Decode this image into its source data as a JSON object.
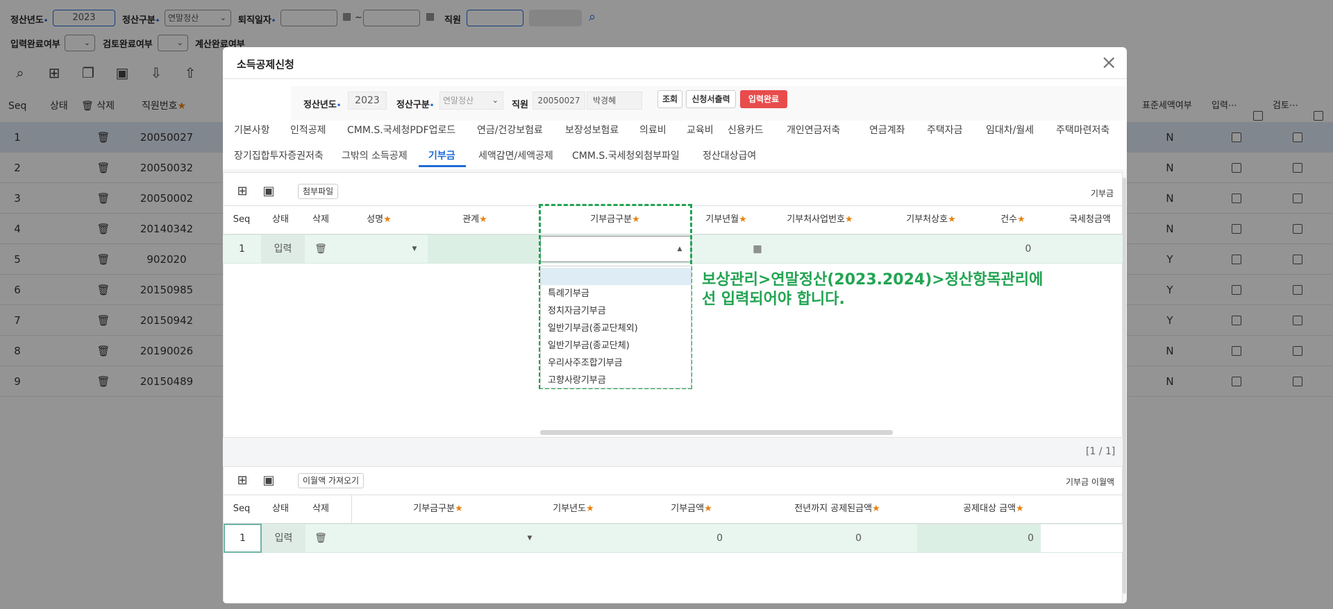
{
  "filter": {
    "year_label": "정산년도",
    "year_value": "2023",
    "type_label": "정산구분",
    "type_value": "연말정산",
    "retire_label": "퇴직일자",
    "retire_sep": "~",
    "employee_label": "직원",
    "input_done_label": "입력완료여부",
    "review_done_label": "검토완료여부",
    "calc_done_label": "계산완료여부"
  },
  "grid": {
    "headers": {
      "seq": "Seq",
      "status": "상태",
      "delete": "삭제",
      "emp_no": "직원번호",
      "std_tax": "표준세액여부",
      "input": "입력⋯",
      "review": "검토⋯"
    },
    "rows": [
      {
        "seq": "1",
        "emp_no": "20050027",
        "std": "N"
      },
      {
        "seq": "2",
        "emp_no": "20050032",
        "std": "N"
      },
      {
        "seq": "3",
        "emp_no": "20050002",
        "std": "N"
      },
      {
        "seq": "4",
        "emp_no": "20140342",
        "std": "N"
      },
      {
        "seq": "5",
        "emp_no": "902020",
        "std": "Y"
      },
      {
        "seq": "6",
        "emp_no": "20150985",
        "std": "Y"
      },
      {
        "seq": "7",
        "emp_no": "20150942",
        "std": "Y"
      },
      {
        "seq": "8",
        "emp_no": "20190026",
        "std": "N"
      },
      {
        "seq": "9",
        "emp_no": "20150489",
        "std": "N"
      }
    ]
  },
  "modal": {
    "title": "소득공제신청",
    "close": "×",
    "cond": {
      "year_label": "정산년도",
      "year_value": "2023",
      "type_label": "정산구분",
      "type_value": "연말정산",
      "employee_label": "직원",
      "employee_no": "20050027",
      "employee_name": "박경혜",
      "btn_search": "조회",
      "btn_print": "신청서출력",
      "btn_done": "입력완료"
    },
    "tabs_row1": [
      "기본사항",
      "인적공제",
      "CMM.S.국세청PDF업로드",
      "연금/건강보험료",
      "보장성보험료",
      "의료비",
      "교육비",
      "신용카드",
      "개인연금저축",
      "연금계좌",
      "주택자금",
      "임대차/월세",
      "주택마련저축"
    ],
    "tabs_row2": [
      "장기집합투자증권저축",
      "그밖의 소득공제",
      "기부금",
      "세액감면/세액공제",
      "CMM.S.국세청외첨부파일",
      "정산대상급여"
    ],
    "section1": {
      "attach_label": "첨부파일",
      "section_label": "기부금",
      "headers": {
        "seq": "Seq",
        "status": "상태",
        "delete": "삭제",
        "name": "성명",
        "relation": "관계",
        "donation_type": "기부금구분",
        "donation_month": "기부년월",
        "biz_no": "기부처사업번호",
        "biz_name": "기부처상호",
        "count": "건수",
        "nts_amount": "국세청금액"
      },
      "row": {
        "seq": "1",
        "status": "입력",
        "count": "0"
      },
      "dropdown": [
        "",
        "특례기부금",
        "정치자금기부금",
        "일반기부금(종교단체외)",
        "일반기부금(종교단체)",
        "우리사주조합기부금",
        "고향사랑기부금"
      ],
      "note_line1": "보상관리>연말정산(2023.2024)>정산항목관리에",
      "note_line2": "선 입력되어야 합니다.",
      "pager": "[1 / 1]"
    },
    "section2": {
      "carry_btn": "이월액 가져오기",
      "section_label": "기부금 이월액",
      "headers": {
        "seq": "Seq",
        "status": "상태",
        "delete": "삭제",
        "donation_type": "기부금구분",
        "donation_year": "기부년도",
        "donation_amount": "기부금액",
        "prev_deducted": "전년까지 공제된금액",
        "target_amount": "공제대상 금액"
      },
      "row": {
        "seq": "1",
        "status": "입력",
        "amount": "0",
        "prev": "0",
        "target": "0"
      }
    }
  }
}
